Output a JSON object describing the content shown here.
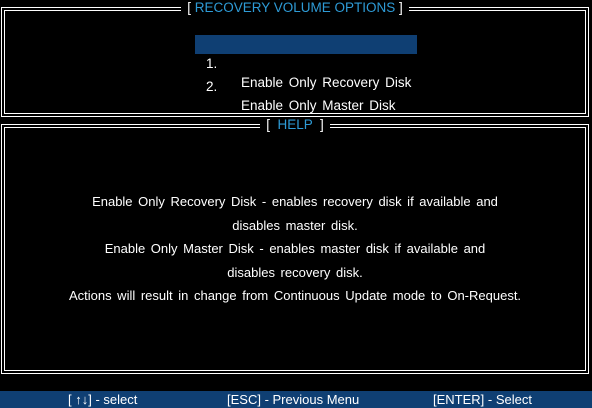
{
  "top_panel": {
    "bracket_open": "[",
    "title": "RECOVERY VOLUME OPTIONS",
    "bracket_close": "]",
    "items": [
      {
        "number": "1.",
        "label": "Enable Only Recovery Disk",
        "selected": true
      },
      {
        "number": "2.",
        "label": "Enable Only Master Disk",
        "selected": false
      }
    ]
  },
  "help_panel": {
    "bracket_open": "[",
    "title": "HELP",
    "bracket_close": "]",
    "lines": [
      "Enable Only Recovery Disk - enables recovery disk if available and",
      "disables master disk.",
      "Enable Only Master Disk - enables master disk if available and",
      "disables recovery disk.",
      "Actions will result in change from Continuous Update mode to On-Request."
    ]
  },
  "status_bar": {
    "select_hint": "[ ↑↓] - select",
    "esc_hint": "[ESC] - Previous Menu",
    "enter_hint": "[ENTER] - Select"
  },
  "colors": {
    "background": "#000000",
    "title_accent": "#2e9bd6",
    "highlight": "#0f3f73",
    "text": "#ffffff"
  }
}
